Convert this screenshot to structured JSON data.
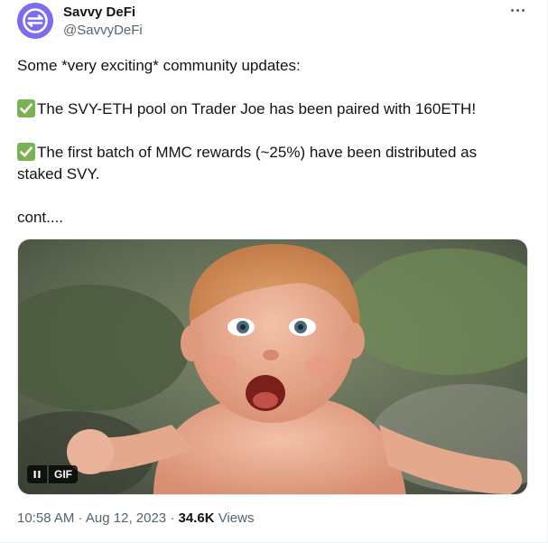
{
  "author": {
    "name": "Savvy DeFi",
    "handle": "@SavvyDeFi",
    "avatar_icon": "savvy-logo-icon",
    "avatar_color": "#7b6cf0"
  },
  "more_icon": "more-horizontal-icon",
  "tweet": {
    "line1": "Some *very exciting* community updates:",
    "line2": "The SVY-ETH pool on Trader Joe has been paired with 160ETH!",
    "line3a": "The first batch of MMC rewards (~25%) have been distributed as",
    "line3b": "staked SVY.",
    "line4": "cont....",
    "check_icon": "check-mark-button-icon",
    "check_color": "#77b255"
  },
  "media": {
    "type": "gif",
    "pause_icon": "pause-icon",
    "badge": "GIF"
  },
  "footer": {
    "time": "10:58 AM",
    "sep1": " · ",
    "date": "Aug 12, 2023",
    "sep2": " · ",
    "views_count": "34.6K",
    "views_label": " Views"
  }
}
